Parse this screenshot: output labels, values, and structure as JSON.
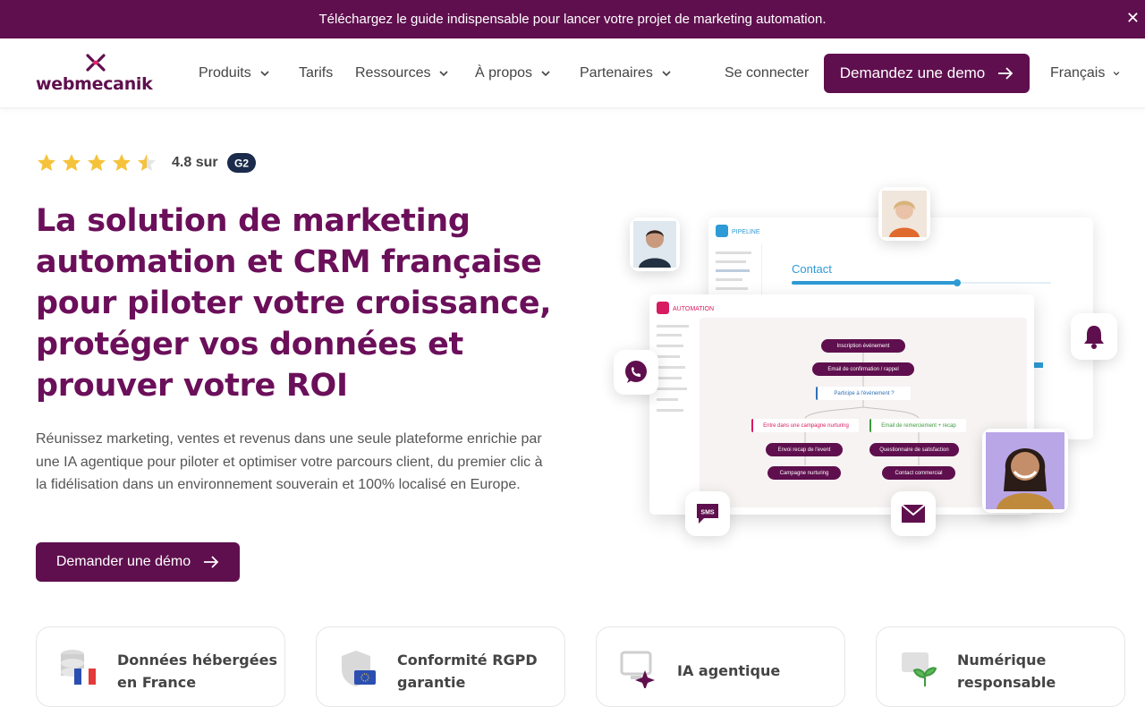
{
  "banner": {
    "text": "Téléchargez le guide indispensable pour lancer votre projet de marketing automation.",
    "close": "✕"
  },
  "logo": {
    "text": "webmecanik"
  },
  "nav": {
    "items": [
      {
        "label": "Produits"
      },
      {
        "label": "Tarifs"
      },
      {
        "label": "Ressources"
      },
      {
        "label": "À propos"
      },
      {
        "label": "Partenaires"
      }
    ],
    "login": "Se connecter",
    "cta": "Demandez une demo",
    "language": "Français"
  },
  "rating": {
    "stars": 4.5,
    "max": 5,
    "text": "4.8 sur",
    "badge": "G2"
  },
  "hero": {
    "title": "La solution de marketing automation et CRM française pour piloter votre croissance, protéger vos données et prouver votre ROI",
    "description": "Réunissez marketing, ventes et revenus dans une seule plateforme enrichie par une IA agentique pour piloter et optimiser votre parcours client, du premier clic à la fidélisation dans un environnement souverain et 100% localisé en Europe.",
    "cta": "Demander une démo"
  },
  "mockup": {
    "pipeline": {
      "brand": "PIPELINE",
      "heading": "Contact"
    },
    "automation": {
      "brand": "AUTOMATION",
      "nodes": [
        "Inscription événement",
        "Email de confirmation / rappel",
        "Participe à l'événement ?",
        "Entre dans une campagne nurturing",
        "Email de remerciement + recap",
        "Envoi recap de l'event",
        "Questionnaire de satisfaction",
        "Campagne nurturing",
        "Contact commercial"
      ]
    },
    "sms_label": "SMS"
  },
  "features": [
    {
      "title": "Données hébergées en France",
      "icon": "server-france-icon"
    },
    {
      "title": "Conformité RGPD garantie",
      "icon": "shield-eu-icon"
    },
    {
      "title": "IA agentique",
      "icon": "ai-sparkle-icon"
    },
    {
      "title": "Numérique responsable",
      "icon": "eco-screen-icon"
    }
  ],
  "colors": {
    "brand": "#5f0f4e",
    "title": "#6b0f5a",
    "star": "#f5c33b"
  }
}
